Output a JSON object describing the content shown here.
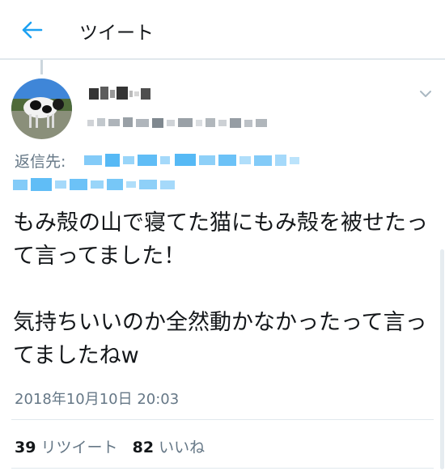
{
  "header": {
    "title": "ツイート",
    "back_icon": "arrow-left-icon"
  },
  "colors": {
    "accent": "#1da1f2",
    "secondary_text": "#657786",
    "primary_text": "#14171a",
    "divider": "#e1e8ed"
  },
  "tweet": {
    "reply_to_label": "返信先:",
    "body": "もみ殻の山で寝てた猫にもみ殻を被せたって言ってました！\n\n気持ちいいのか全然動かなかったって言ってましたねw",
    "timestamp": "2018年10月10日 20:03",
    "retweets": {
      "count": "39",
      "label": "リツイート"
    },
    "likes": {
      "count": "82",
      "label": "いいね"
    }
  }
}
